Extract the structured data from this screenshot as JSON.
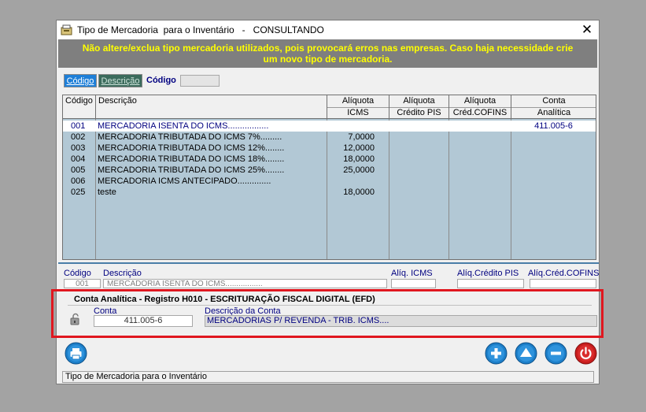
{
  "window": {
    "title": "Tipo de Mercadoria  para o Inventário   -   CONSULTANDO",
    "close_label": "✕"
  },
  "warning": {
    "line1": "Não altere/exclua tipo mercadoria utilizados, pois provocará erros nas empresas. Caso haja necessidade crie",
    "line2": "um novo tipo de mercadoria."
  },
  "search": {
    "tabs": [
      "Código",
      "Descrição"
    ],
    "field_label": "Código",
    "field_value": ""
  },
  "grid": {
    "headers": {
      "codigo": "Código",
      "descricao": "Descrição",
      "aliquota_icms": [
        "Alíquota",
        "ICMS"
      ],
      "aliquota_credito_pis": [
        "Alíquota",
        "Crédito PIS"
      ],
      "aliquota_cred_cofins": [
        "Alíquota",
        "Créd.COFINS"
      ],
      "conta_analitica": [
        "Conta",
        "Analítica"
      ]
    },
    "rows": [
      {
        "codigo": "001",
        "descricao": "MERCADORIA ISENTA DO ICMS.................",
        "icms": "",
        "pis": "",
        "cofins": "",
        "conta": "411.005-6",
        "selected": true
      },
      {
        "codigo": "002",
        "descricao": "MERCADORIA TRIBUTADA DO ICMS 7%.........",
        "icms": "7,0000",
        "pis": "",
        "cofins": "",
        "conta": "",
        "selected": false
      },
      {
        "codigo": "003",
        "descricao": "MERCADORIA TRIBUTADA DO ICMS 12%........",
        "icms": "12,0000",
        "pis": "",
        "cofins": "",
        "conta": "",
        "selected": false
      },
      {
        "codigo": "004",
        "descricao": "MERCADORIA TRIBUTADA DO ICMS 18%........",
        "icms": "18,0000",
        "pis": "",
        "cofins": "",
        "conta": "",
        "selected": false
      },
      {
        "codigo": "005",
        "descricao": "MERCADORIA TRIBUTADA DO ICMS 25%........",
        "icms": "25,0000",
        "pis": "",
        "cofins": "",
        "conta": "",
        "selected": false
      },
      {
        "codigo": "006",
        "descricao": "MERCADORIA ICMS ANTECIPADO..............",
        "icms": "",
        "pis": "",
        "cofins": "",
        "conta": "",
        "selected": false
      },
      {
        "codigo": "025",
        "descricao": "teste",
        "icms": "18,0000",
        "pis": "",
        "cofins": "",
        "conta": "",
        "selected": false
      }
    ]
  },
  "form": {
    "labels": {
      "codigo": "Código",
      "descricao": "Descrição",
      "aliq_icms": "Alíq. ICMS",
      "aliq_credito_pis": "Alíq.Crédito PIS",
      "aliq_cred_cofins": "Alíq.Créd.COFINS"
    },
    "values": {
      "codigo": "001",
      "descricao": "MERCADORIA ISENTA DO ICMS.................",
      "aliq_icms": "",
      "aliq_credito_pis": "",
      "aliq_cred_cofins": ""
    }
  },
  "conta_group": {
    "title": "Conta Analítica - Registro H010 - ESCRITURAÇÃO FISCAL DIGITAL (EFD)",
    "conta_label": "Conta",
    "conta_value": "411.005-6",
    "descricao_label": "Descrição da Conta",
    "descricao_value": "MERCADORIAS P/ REVENDA - TRIB. ICMS...."
  },
  "buttons": {
    "print_icon": "printer-icon",
    "add_icon": "plus-icon",
    "up_icon": "arrow-up-icon",
    "remove_icon": "minus-icon",
    "exit_icon": "power-icon"
  },
  "status_bar": "Tipo de Mercadoria para o Inventário",
  "colors": {
    "warning_bg": "#7f7f7f",
    "warning_text": "#ffff00",
    "grid_bg": "#b2c8d5",
    "accent_blue": "#1e7fd8",
    "highlight_red": "#e0171f"
  }
}
